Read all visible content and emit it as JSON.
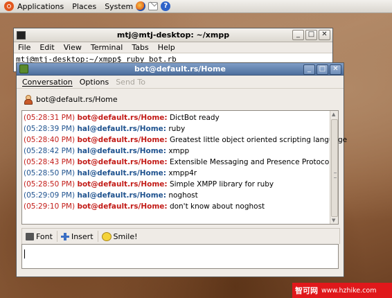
{
  "top_panel": {
    "menus": [
      "Applications",
      "Places",
      "System"
    ],
    "launchers": [
      "firefox-icon",
      "mail-icon",
      "help-icon"
    ]
  },
  "terminal": {
    "title": "mtj@mtj-desktop: ~/xmpp",
    "menus": [
      "File",
      "Edit",
      "View",
      "Terminal",
      "Tabs",
      "Help"
    ],
    "command_line": "mtj@mtj-desktop:~/xmpp$ ruby bot.rb"
  },
  "chat": {
    "title": "bot@default.rs/Home",
    "menus": [
      "Conversation",
      "Options",
      "Send To"
    ],
    "contact": "bot@default.rs/Home",
    "messages": [
      {
        "time": "(05:28:31 PM)",
        "sender": "bot@default.rs/Home:",
        "text": "DictBot ready",
        "kind": "bot"
      },
      {
        "time": "(05:28:39 PM)",
        "sender": "hal@default.rs/Home:",
        "text": "ruby",
        "kind": "hal"
      },
      {
        "time": "(05:28:40 PM)",
        "sender": "bot@default.rs/Home:",
        "text": "Greatest little object oriented scripting language",
        "kind": "bot"
      },
      {
        "time": "(05:28:42 PM)",
        "sender": "hal@default.rs/Home:",
        "text": "xmpp",
        "kind": "hal"
      },
      {
        "time": "(05:28:43 PM)",
        "sender": "bot@default.rs/Home:",
        "text": "Extensible Messaging and Presence Protocol",
        "kind": "bot"
      },
      {
        "time": "(05:28:50 PM)",
        "sender": "hal@default.rs/Home:",
        "text": "xmpp4r",
        "kind": "hal"
      },
      {
        "time": "(05:28:50 PM)",
        "sender": "bot@default.rs/Home:",
        "text": "Simple XMPP library for ruby",
        "kind": "bot"
      },
      {
        "time": "(05:29:09 PM)",
        "sender": "hal@default.rs/Home:",
        "text": "noghost",
        "kind": "hal"
      },
      {
        "time": "(05:29:10 PM)",
        "sender": "bot@default.rs/Home:",
        "text": "don't know about noghost",
        "kind": "bot"
      }
    ],
    "toolbar": {
      "font": "Font",
      "insert": "Insert",
      "smile": "Smile!"
    },
    "colors": {
      "bot": "#c21b17",
      "hal": "#20538f"
    }
  },
  "watermark": {
    "brand": "智可网",
    "url": "www.hzhike.com"
  }
}
